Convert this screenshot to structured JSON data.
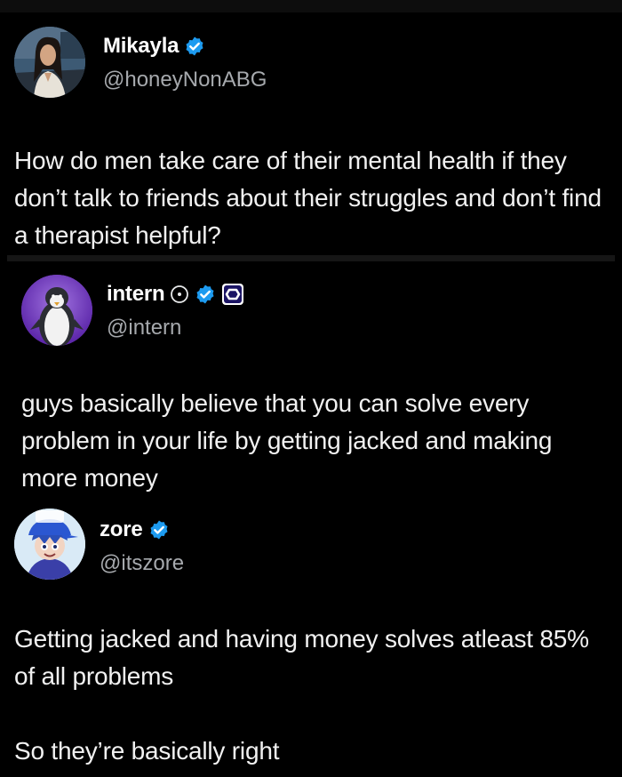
{
  "posts": [
    {
      "name": "Mikayla",
      "handle": "@honeyNonABG",
      "text": "How do men take care of their mental health if they don’t talk to friends about their struggles and don’t find a therapist helpful?",
      "badges": [
        "verified-icon"
      ],
      "avatar": "profile-photo-woman"
    },
    {
      "name": "intern",
      "handle": "@intern",
      "text": "guys basically believe that you can solve every problem in your life by getting jacked and making more money",
      "badges": [
        "clock-icon",
        "verified-icon",
        "affiliate-badge-icon"
      ],
      "avatar": "penguin-avatar"
    },
    {
      "name": "zore",
      "handle": "@itszore",
      "text": "Getting jacked and having money solves atleast 85% of all problems\n\nSo they’re basically right",
      "badges": [
        "verified-icon"
      ],
      "avatar": "cartoon-avatar"
    }
  ],
  "colors": {
    "background": "#000000",
    "verified": "#1d9bf0",
    "handle": "#a6a9ad",
    "text": "#f1f1f1"
  }
}
